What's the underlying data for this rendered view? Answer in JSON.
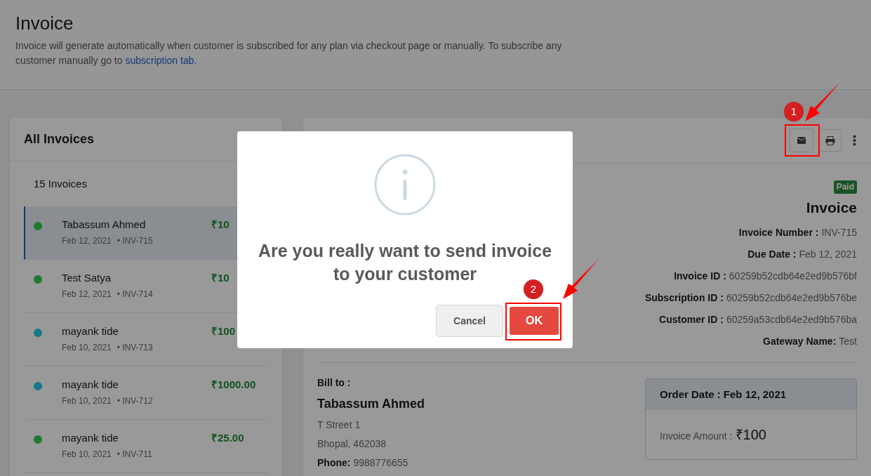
{
  "page": {
    "title": "Invoice",
    "description": "Invoice will generate automatically when customer is subscribed for any plan via checkout page or manually. To subscribe any customer manually go to ",
    "link": "subscription tab."
  },
  "invoice_list": {
    "title": "All Invoices",
    "count": "15 Invoices",
    "items": [
      {
        "name": "Tabassum Ahmed",
        "date": "Feb 12, 2021",
        "number": "• INV-715",
        "amount": "₹10",
        "color": "#1f7a31",
        "selected": true
      },
      {
        "name": "Test Satya",
        "date": "Feb 12, 2021",
        "number": "• INV-714",
        "amount": "₹10",
        "color": "#1f7a31",
        "selected": false
      },
      {
        "name": "mayank tide",
        "date": "Feb 10, 2021",
        "number": "• INV-713",
        "amount": "₹100",
        "color": "#167987",
        "selected": false
      },
      {
        "name": "mayank tide",
        "date": "Feb 10, 2021",
        "number": "• INV-712",
        "amount": "₹1000.00",
        "color": "#167987",
        "selected": false
      },
      {
        "name": "mayank tide",
        "date": "Feb 10, 2021",
        "number": "• INV-711",
        "amount": "₹25.00",
        "color": "#1f7a31",
        "selected": false
      }
    ]
  },
  "invoice_detail": {
    "status": "Paid",
    "title": "Invoice",
    "fields": [
      {
        "label": "Invoice Number :",
        "value": "INV-715"
      },
      {
        "label": "Due Date :",
        "value": "Feb 12, 2021"
      },
      {
        "label": "Invoice ID :",
        "value": "60259b52cdb64e2ed9b576bf"
      },
      {
        "label": "Subscription ID :",
        "value": "60259b52cdb64e2ed9b576be"
      },
      {
        "label": "Customer ID :",
        "value": "60259a53cdb64e2ed9b576ba"
      },
      {
        "label": "Gateway Name:",
        "value": "Test"
      }
    ],
    "bill_to": {
      "label": "Bill to :",
      "name": "Tabassum Ahmed",
      "lines": [
        "T Street 1",
        "Bhopal, 462038"
      ],
      "phone_label": "Phone:",
      "phone": "9988776655"
    },
    "order": {
      "date": "Order Date : Feb 12, 2021",
      "amount_label": "Invoice Amount :",
      "amount": "₹100"
    }
  },
  "dialog": {
    "message": "Are you really want to send invoice to your customer",
    "cancel": "Cancel",
    "ok": "OK"
  },
  "annotations": [
    {
      "label": "1"
    },
    {
      "label": "2"
    }
  ]
}
